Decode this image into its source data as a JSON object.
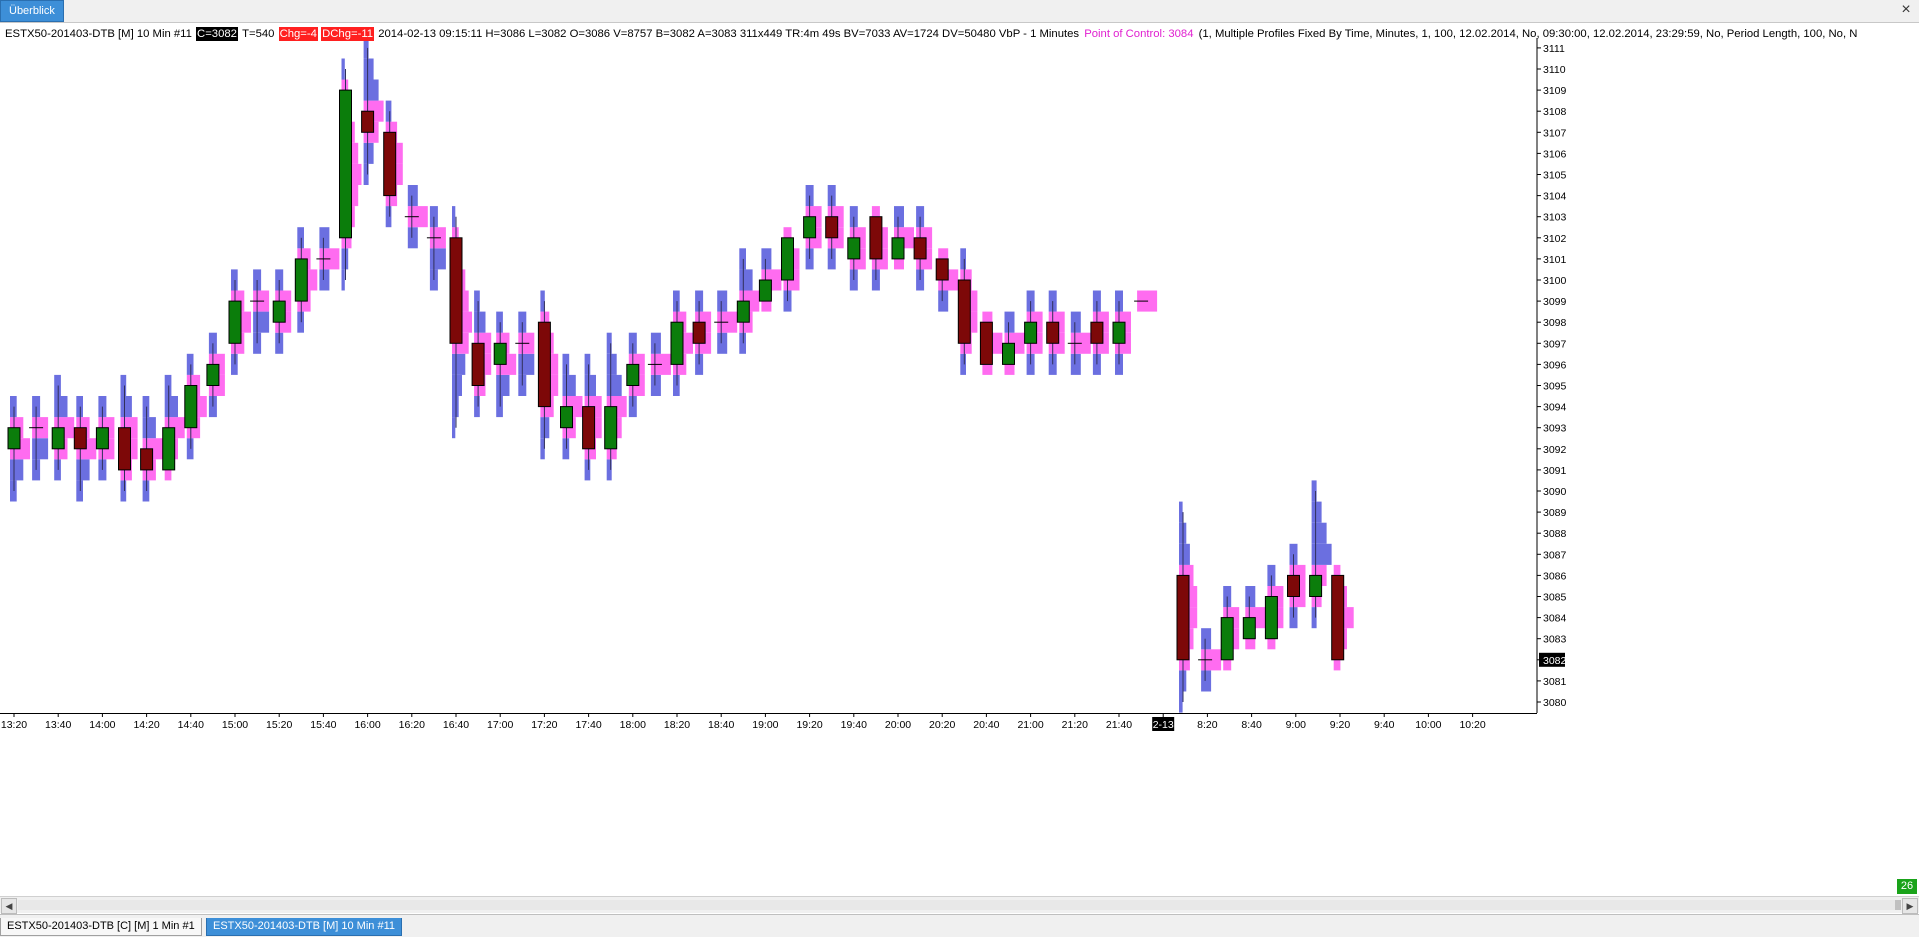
{
  "toolbar": {
    "overview_label": "Überblick",
    "close_label": "×"
  },
  "infobar": {
    "instrument": "ESTX50-201403-DTB [M]  10 Min   #11",
    "close_tag": "C=3082",
    "ticks": "T=540",
    "chg_tag": "Chg=-4",
    "dchg_tag": "DChg=-11",
    "details": "2014-02-13 09:15:11  H=3086  L=3082  O=3086  V=8757  B=3082  A=3083  311x449  TR:4m 49s  BV=7033  AV=1724  DV=50480   VbP - 1 Minutes",
    "poc": "Point of Control: 3084",
    "params": "(1, Multiple Profiles Fixed By Time, Minutes, 1, 100, 12.02.2014, No, 09:30:00, 12.02.2014, 23:29:59, No, Period Length, 100, No, N"
  },
  "tabs": [
    {
      "label": "ESTX50-201403-DTB [C] [M]  1 Min   #1"
    },
    {
      "label": "ESTX50-201403-DTB [M]  10 Min   #11"
    }
  ],
  "badge": "26",
  "colors": {
    "up": "#0b7d0b",
    "down": "#7d0808",
    "profile_blue": "#6b6fe0",
    "profile_pink": "#ff6cf0",
    "last_price_bg": "#000000",
    "date_marker_bg": "#000000"
  },
  "chart_data": {
    "type": "candlestick",
    "ylim": [
      3080,
      3111
    ],
    "y_ticks": [
      3080,
      3081,
      3082,
      3083,
      3084,
      3085,
      3086,
      3087,
      3088,
      3089,
      3090,
      3091,
      3092,
      3093,
      3094,
      3095,
      3096,
      3097,
      3098,
      3099,
      3100,
      3101,
      3102,
      3103,
      3104,
      3105,
      3106,
      3107,
      3108,
      3109,
      3110,
      3111
    ],
    "last_price_label": "3082",
    "x_tick_labels": [
      "13:20",
      "13:40",
      "14:00",
      "14:20",
      "14:40",
      "15:00",
      "15:20",
      "15:40",
      "16:00",
      "16:20",
      "16:40",
      "17:00",
      "17:20",
      "17:40",
      "18:00",
      "18:20",
      "18:40",
      "19:00",
      "19:20",
      "19:40",
      "20:00",
      "20:20",
      "20:40",
      "21:00",
      "21:20",
      "21:40",
      "2-13",
      "8:20",
      "8:40",
      "9:00",
      "9:20",
      "9:40",
      "10:00",
      "10:20"
    ],
    "date_marker": "2-13",
    "candles": [
      {
        "time": "13:10",
        "open": 3092,
        "close": 3093,
        "high": 3094,
        "low": 3090
      },
      {
        "time": "13:20",
        "open": 3093,
        "close": 3093,
        "high": 3094,
        "low": 3091
      },
      {
        "time": "13:30",
        "open": 3092,
        "close": 3093,
        "high": 3095,
        "low": 3091
      },
      {
        "time": "13:40",
        "open": 3093,
        "close": 3092,
        "high": 3094,
        "low": 3090
      },
      {
        "time": "13:50",
        "open": 3092,
        "close": 3093,
        "high": 3094,
        "low": 3091
      },
      {
        "time": "14:00",
        "open": 3093,
        "close": 3091,
        "high": 3095,
        "low": 3090
      },
      {
        "time": "14:10",
        "open": 3092,
        "close": 3091,
        "high": 3094,
        "low": 3090
      },
      {
        "time": "14:20",
        "open": 3091,
        "close": 3093,
        "high": 3095,
        "low": 3091
      },
      {
        "time": "14:30",
        "open": 3093,
        "close": 3095,
        "high": 3096,
        "low": 3092
      },
      {
        "time": "14:40",
        "open": 3095,
        "close": 3096,
        "high": 3097,
        "low": 3094
      },
      {
        "time": "14:50",
        "open": 3097,
        "close": 3099,
        "high": 3100,
        "low": 3096
      },
      {
        "time": "15:00",
        "open": 3099,
        "close": 3099,
        "high": 3100,
        "low": 3097
      },
      {
        "time": "15:10",
        "open": 3098,
        "close": 3099,
        "high": 3100,
        "low": 3097
      },
      {
        "time": "15:20",
        "open": 3099,
        "close": 3101,
        "high": 3102,
        "low": 3098
      },
      {
        "time": "15:30",
        "open": 3101,
        "close": 3101,
        "high": 3102,
        "low": 3100
      },
      {
        "time": "15:40",
        "open": 3102,
        "close": 3109,
        "high": 3110,
        "low": 3100
      },
      {
        "time": "15:50",
        "open": 3108,
        "close": 3107,
        "high": 3111,
        "low": 3105
      },
      {
        "time": "16:00",
        "open": 3107,
        "close": 3104,
        "high": 3108,
        "low": 3103
      },
      {
        "time": "16:10",
        "open": 3103,
        "close": 3103,
        "high": 3104,
        "low": 3102
      },
      {
        "time": "16:20",
        "open": 3102,
        "close": 3102,
        "high": 3103,
        "low": 3100
      },
      {
        "time": "16:30",
        "open": 3102,
        "close": 3097,
        "high": 3103,
        "low": 3093
      },
      {
        "time": "16:40",
        "open": 3097,
        "close": 3095,
        "high": 3099,
        "low": 3094
      },
      {
        "time": "16:50",
        "open": 3096,
        "close": 3097,
        "high": 3098,
        "low": 3094
      },
      {
        "time": "17:00",
        "open": 3097,
        "close": 3097,
        "high": 3098,
        "low": 3095
      },
      {
        "time": "17:10",
        "open": 3098,
        "close": 3094,
        "high": 3099,
        "low": 3092
      },
      {
        "time": "17:20",
        "open": 3093,
        "close": 3094,
        "high": 3096,
        "low": 3092
      },
      {
        "time": "17:30",
        "open": 3094,
        "close": 3092,
        "high": 3096,
        "low": 3091
      },
      {
        "time": "17:40",
        "open": 3092,
        "close": 3094,
        "high": 3097,
        "low": 3091
      },
      {
        "time": "17:50",
        "open": 3095,
        "close": 3096,
        "high": 3097,
        "low": 3094
      },
      {
        "time": "18:00",
        "open": 3096,
        "close": 3096,
        "high": 3097,
        "low": 3095
      },
      {
        "time": "18:10",
        "open": 3096,
        "close": 3098,
        "high": 3099,
        "low": 3095
      },
      {
        "time": "18:20",
        "open": 3098,
        "close": 3097,
        "high": 3099,
        "low": 3096
      },
      {
        "time": "18:30",
        "open": 3098,
        "close": 3098,
        "high": 3099,
        "low": 3097
      },
      {
        "time": "18:40",
        "open": 3098,
        "close": 3099,
        "high": 3101,
        "low": 3097
      },
      {
        "time": "18:50",
        "open": 3099,
        "close": 3100,
        "high": 3101,
        "low": 3099
      },
      {
        "time": "19:00",
        "open": 3100,
        "close": 3102,
        "high": 3102,
        "low": 3099
      },
      {
        "time": "19:10",
        "open": 3102,
        "close": 3103,
        "high": 3104,
        "low": 3101
      },
      {
        "time": "19:20",
        "open": 3103,
        "close": 3102,
        "high": 3104,
        "low": 3101
      },
      {
        "time": "19:30",
        "open": 3101,
        "close": 3102,
        "high": 3103,
        "low": 3100
      },
      {
        "time": "19:40",
        "open": 3103,
        "close": 3101,
        "high": 3103,
        "low": 3100
      },
      {
        "time": "19:50",
        "open": 3101,
        "close": 3102,
        "high": 3103,
        "low": 3101
      },
      {
        "time": "20:00",
        "open": 3102,
        "close": 3101,
        "high": 3103,
        "low": 3100
      },
      {
        "time": "20:10",
        "open": 3101,
        "close": 3100,
        "high": 3101,
        "low": 3099
      },
      {
        "time": "20:20",
        "open": 3100,
        "close": 3097,
        "high": 3101,
        "low": 3096
      },
      {
        "time": "20:30",
        "open": 3098,
        "close": 3096,
        "high": 3098,
        "low": 3096
      },
      {
        "time": "20:40",
        "open": 3096,
        "close": 3097,
        "high": 3098,
        "low": 3096
      },
      {
        "time": "20:50",
        "open": 3097,
        "close": 3098,
        "high": 3099,
        "low": 3096
      },
      {
        "time": "21:00",
        "open": 3098,
        "close": 3097,
        "high": 3099,
        "low": 3096
      },
      {
        "time": "21:10",
        "open": 3097,
        "close": 3097,
        "high": 3098,
        "low": 3096
      },
      {
        "time": "21:20",
        "open": 3098,
        "close": 3097,
        "high": 3099,
        "low": 3096
      },
      {
        "time": "21:30",
        "open": 3097,
        "close": 3098,
        "high": 3099,
        "low": 3096
      },
      {
        "time": "21:40",
        "open": 3099,
        "close": 3099,
        "high": 3099,
        "low": 3099
      },
      {
        "time": "08:00",
        "open": 3086,
        "close": 3082,
        "high": 3089,
        "low": 3080
      },
      {
        "time": "08:10",
        "open": 3082,
        "close": 3082,
        "high": 3083,
        "low": 3081
      },
      {
        "time": "08:20",
        "open": 3082,
        "close": 3084,
        "high": 3085,
        "low": 3082
      },
      {
        "time": "08:30",
        "open": 3083,
        "close": 3084,
        "high": 3085,
        "low": 3083
      },
      {
        "time": "08:40",
        "open": 3083,
        "close": 3085,
        "high": 3086,
        "low": 3083
      },
      {
        "time": "08:50",
        "open": 3086,
        "close": 3085,
        "high": 3087,
        "low": 3084
      },
      {
        "time": "09:00",
        "open": 3085,
        "close": 3086,
        "high": 3090,
        "low": 3084
      },
      {
        "time": "09:10",
        "open": 3086,
        "close": 3082,
        "high": 3086,
        "low": 3082
      }
    ]
  }
}
